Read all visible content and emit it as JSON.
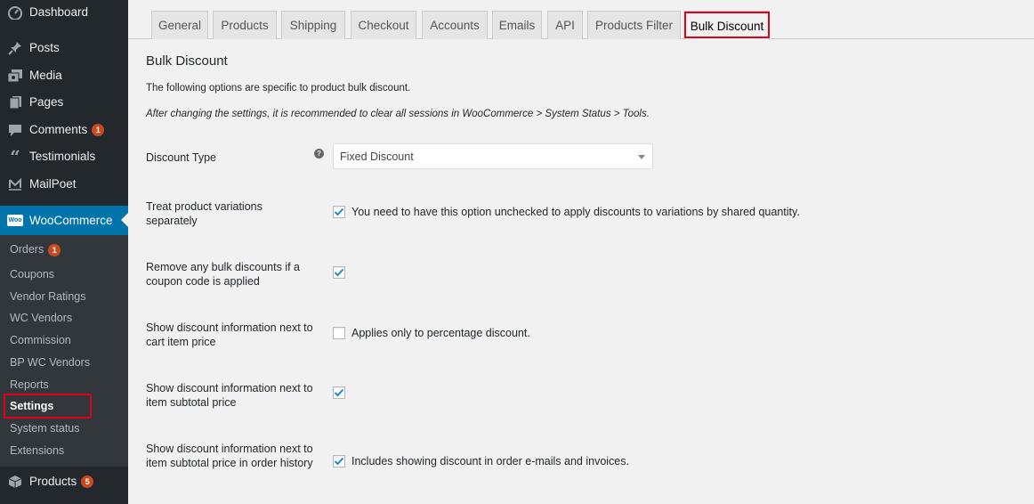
{
  "sidebar": {
    "items": [
      {
        "label": "Dashboard",
        "icon": "dashboard-icon",
        "badge": ""
      },
      {
        "label": "Posts",
        "icon": "pin-icon",
        "badge": ""
      },
      {
        "label": "Media",
        "icon": "media-icon",
        "badge": ""
      },
      {
        "label": "Pages",
        "icon": "pages-icon",
        "badge": ""
      },
      {
        "label": "Comments",
        "icon": "comment-icon",
        "badge": "1"
      },
      {
        "label": "Testimonials",
        "icon": "quote-icon",
        "badge": ""
      },
      {
        "label": "MailPoet",
        "icon": "mailpoet-icon",
        "badge": ""
      },
      {
        "label": "WooCommerce",
        "icon": "woo-icon",
        "badge": ""
      },
      {
        "label": "Products",
        "icon": "box-icon",
        "badge": "5"
      }
    ],
    "woo_logo_text": "Woo",
    "submenu": [
      {
        "label": "Orders",
        "badge": "1"
      },
      {
        "label": "Coupons",
        "badge": ""
      },
      {
        "label": "Vendor Ratings",
        "badge": ""
      },
      {
        "label": "WC Vendors",
        "badge": ""
      },
      {
        "label": "Commission",
        "badge": ""
      },
      {
        "label": "BP WC Vendors",
        "badge": ""
      },
      {
        "label": "Reports",
        "badge": ""
      },
      {
        "label": "Settings",
        "badge": ""
      },
      {
        "label": "System status",
        "badge": ""
      },
      {
        "label": "Extensions",
        "badge": ""
      }
    ],
    "colors": {
      "bg": "#23282d",
      "submenu_bg": "#32373c",
      "current": "#0073aa",
      "badge": "#ca4a1f",
      "highlight": "#e0001b"
    }
  },
  "tabs": [
    {
      "label": "General"
    },
    {
      "label": "Products"
    },
    {
      "label": "Shipping"
    },
    {
      "label": "Checkout"
    },
    {
      "label": "Accounts"
    },
    {
      "label": "Emails"
    },
    {
      "label": "API"
    },
    {
      "label": "Products Filter"
    },
    {
      "label": "Bulk Discount",
      "active": true
    }
  ],
  "section": {
    "title": "Bulk Discount",
    "description": "The following options are specific to product bulk discount.",
    "note": "After changing the settings, it is recommended to clear all sessions in WooCommerce > System Status > Tools."
  },
  "fields": {
    "discount_type": {
      "label": "Discount Type",
      "help": "?",
      "value": "Fixed Discount"
    },
    "variations": {
      "label": "Treat product variations separately",
      "checked": true,
      "description": "You need to have this option unchecked to apply discounts to variations by shared quantity."
    },
    "coupon": {
      "label": "Remove any bulk discounts if a coupon code is applied",
      "checked": true,
      "description": ""
    },
    "cart_price": {
      "label": "Show discount information next to cart item price",
      "checked": false,
      "description": "Applies only to percentage discount."
    },
    "subtotal": {
      "label": "Show discount information next to item subtotal price",
      "checked": true,
      "description": ""
    },
    "order_history": {
      "label": "Show discount information next to item subtotal price in order history",
      "checked": true,
      "description": "Includes showing discount in order e-mails and invoices."
    }
  }
}
